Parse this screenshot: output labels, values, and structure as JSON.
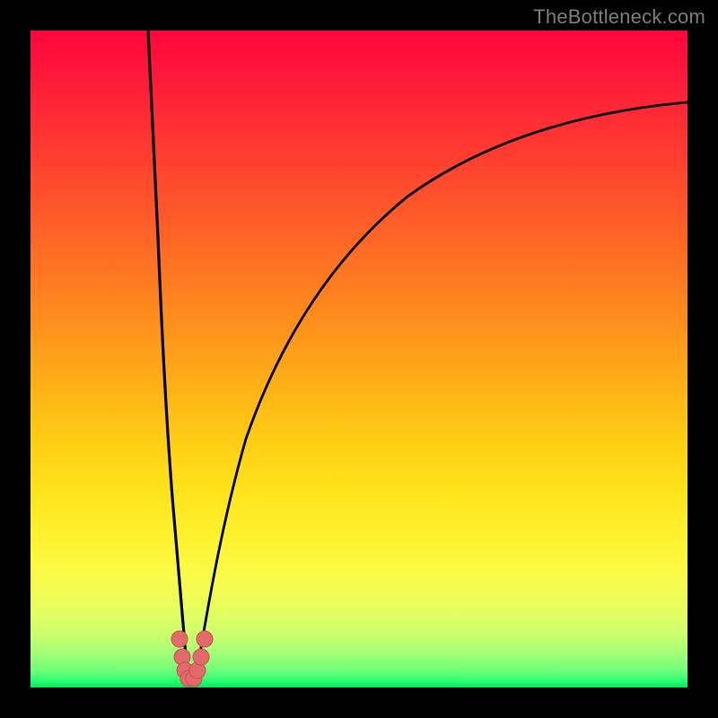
{
  "watermark": "TheBottleneck.com",
  "colors": {
    "frame": "#000000",
    "curve": "#000000",
    "marker_fill": "#e36a6a",
    "marker_stroke": "#c94f4f",
    "gradient_top": "#ff053c",
    "gradient_bottom": "#00e85d"
  },
  "chart_data": {
    "type": "line",
    "title": "",
    "xlabel": "",
    "ylabel": "",
    "xlim": [
      0,
      100
    ],
    "ylim": [
      0,
      100
    ],
    "grid": false,
    "legend": false,
    "series": [
      {
        "name": "left-branch",
        "x": [
          18,
          18.5,
          19,
          19.5,
          20,
          20.75,
          21.5,
          22.25,
          23,
          23.5,
          24
        ],
        "y": [
          100,
          90,
          79,
          67,
          55,
          41,
          28,
          17,
          8,
          4,
          0
        ]
      },
      {
        "name": "right-branch",
        "x": [
          24,
          25,
          26,
          27.5,
          30,
          34,
          40,
          48,
          58,
          70,
          84,
          100
        ],
        "y": [
          0,
          6,
          13,
          22,
          34,
          47,
          58,
          67,
          74,
          80,
          85,
          89
        ]
      }
    ],
    "markers": [
      {
        "x": 22.7,
        "y": 7.2
      },
      {
        "x": 23.0,
        "y": 4.3
      },
      {
        "x": 23.4,
        "y": 2.4
      },
      {
        "x": 23.8,
        "y": 1.3
      },
      {
        "x": 24.2,
        "y": 1.3
      },
      {
        "x": 24.6,
        "y": 2.4
      },
      {
        "x": 25.0,
        "y": 4.3
      },
      {
        "x": 25.4,
        "y": 7.2
      }
    ]
  }
}
